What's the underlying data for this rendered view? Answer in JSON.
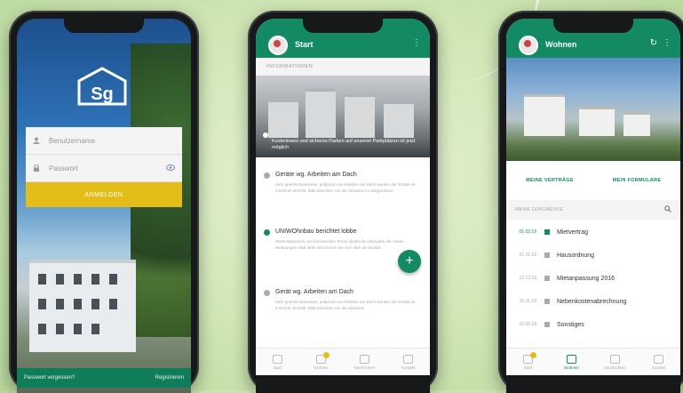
{
  "phone1": {
    "logo_text": "Sg",
    "username_placeholder": "Benutzername",
    "password_placeholder": "Passwort",
    "login_label": "ANMELDEN",
    "forgot_label": "Passwort vergessen?",
    "register_label": "Registrieren"
  },
  "phone2": {
    "title": "Start",
    "section_label": "INFORMATIONEN",
    "hero_text": "Kostenloses und sicheres Parken auf unseren Parkplätzen ist jetzt möglich",
    "news": [
      {
        "title": "Geräte wg. Arbeiten am Dach",
        "body": "Sehr geehrte Bewohner, aufgrund von Arbeiten am Dach werden die Geräte im Innenhof verstellt. Bitte beachten Sie die Hinweise im Stiegenhaus."
      },
      {
        "title": "UNIWOhnbau berichtet lobbe",
        "body": "Werte Bewohner, am kommenden Termin findet die Übergabe der neuen Wohnungen statt. Bitte informieren Sie sich über die Details."
      },
      {
        "title": "Gerät wg. Arbeiten am Dach",
        "body": "Sehr geehrte Bewohner, aufgrund von Arbeiten am Dach werden die Geräte im Innenhof verstellt. Bitte beachten Sie die Hinweise."
      }
    ],
    "fab": "+",
    "nav": [
      "Start",
      "Wohnen",
      "Nachrichten",
      "Kontakt"
    ],
    "colors": {
      "news_dot_active": "#138a63",
      "news_dot": "#aaaaaa"
    }
  },
  "phone3": {
    "title": "Wohnen",
    "tab_left": "MEINE VERTRÄGE",
    "tab_right": "MEIN FORMULARE",
    "search_placeholder": "MEINE DOKUMENTE",
    "rows": [
      {
        "date": "01.02.19",
        "label": "Mietvertrag",
        "active": true
      },
      {
        "date": "01.01.19",
        "label": "Hausordnung",
        "active": false
      },
      {
        "date": "12.12.18",
        "label": "Mietanpassung 2016",
        "active": false
      },
      {
        "date": "10.11.18",
        "label": "Nebenkostenabrechnung",
        "active": false
      },
      {
        "date": "02.05.18",
        "label": "Sonstiges",
        "active": false
      }
    ],
    "nav": [
      "Start",
      "Wohnen",
      "Nachrichten",
      "Kontakt"
    ]
  },
  "colors": {
    "brand_green": "#138a63",
    "accent_yellow": "#e3be19"
  }
}
